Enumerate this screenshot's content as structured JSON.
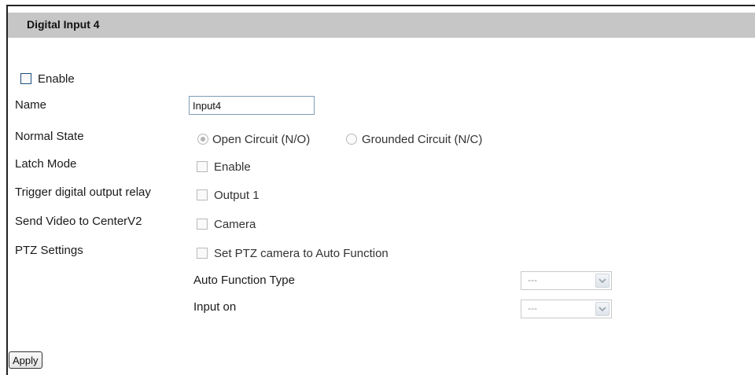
{
  "panel": {
    "title": "Digital Input 4"
  },
  "enable": {
    "label": "Enable",
    "checked": false
  },
  "name": {
    "label": "Name",
    "value": "Input4"
  },
  "normal_state": {
    "label": "Normal State",
    "options": [
      "Open Circuit (N/O)",
      "Grounded Circuit (N/C)"
    ],
    "selected": "Open Circuit (N/O)"
  },
  "latch_mode": {
    "label": "Latch Mode",
    "checkbox_label": "Enable"
  },
  "trigger_output": {
    "label": "Trigger digital output relay",
    "checkbox_label": "Output 1"
  },
  "send_video": {
    "label": "Send Video to CenterV2",
    "checkbox_label": "Camera"
  },
  "ptz": {
    "label": "PTZ Settings",
    "checkbox_label": "Set PTZ camera to Auto Function",
    "auto_function_type": {
      "label": "Auto Function Type",
      "value": "---"
    },
    "input_on": {
      "label": "Input on",
      "value": "---"
    }
  },
  "apply_label": "Apply"
}
